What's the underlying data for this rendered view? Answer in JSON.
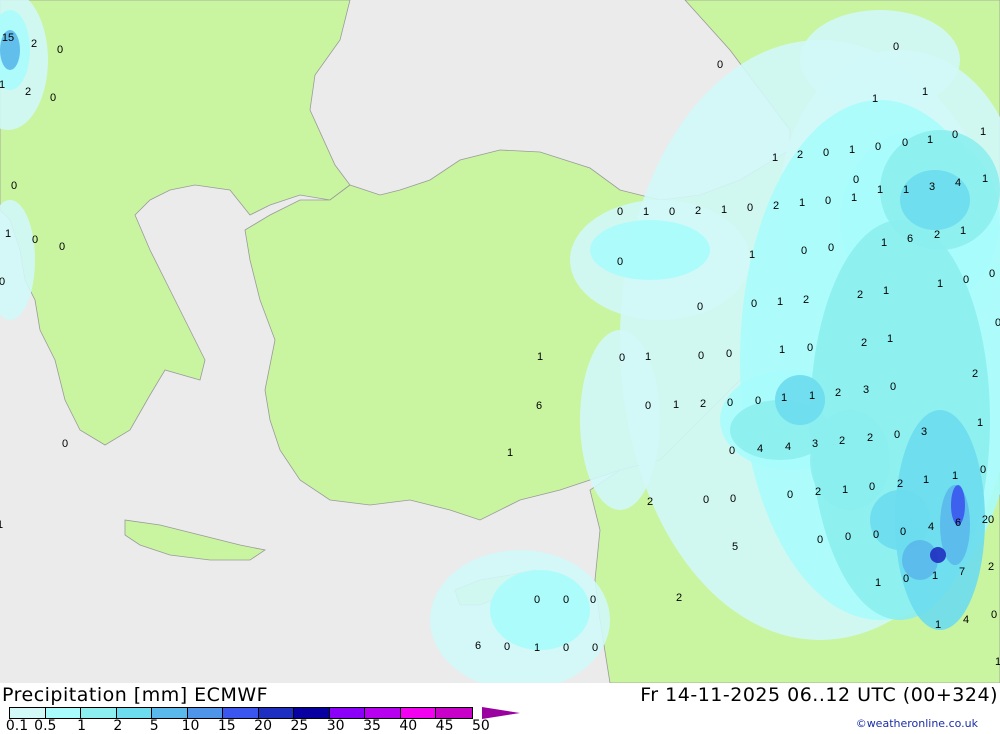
{
  "title": "Precipitation [mm] ECMWF",
  "valid_time": "Fr 14-11-2025 06..12 UTC (00+324)",
  "credit": "©weatheronline.co.uk",
  "colors": {
    "sea": "#ebebeb",
    "land": "#c9f5a0",
    "border": "#a0a0a0"
  },
  "legend": {
    "ticks": [
      "0.1",
      "0.5",
      "1",
      "2",
      "5",
      "10",
      "15",
      "20",
      "25",
      "30",
      "35",
      "40",
      "45",
      "50"
    ],
    "colors": [
      "#d2f8f8",
      "#a8fcfc",
      "#8ceeee",
      "#6cdcee",
      "#5ab8ea",
      "#4e94e8",
      "#3a56ee",
      "#1e2ec0",
      "#0800a0",
      "#8a00f8",
      "#b800f0",
      "#f200f0",
      "#c800c8"
    ],
    "overflow_color": "#9a00a0"
  },
  "station_values": [
    "15",
    "2",
    "0",
    "1",
    "2",
    "0",
    "0",
    "1",
    "0",
    "0",
    "0",
    "0",
    "1",
    "0",
    "0",
    "1",
    "1",
    "1",
    "0",
    "1",
    "0",
    "0",
    "1",
    "0",
    "2",
    "1",
    "0",
    "1",
    "1",
    "3",
    "4",
    "1",
    "0",
    "1",
    "0",
    "2",
    "1",
    "0",
    "2",
    "1",
    "0",
    "1",
    "1",
    "6",
    "2",
    "1",
    "0",
    "1",
    "0",
    "0",
    "0",
    "0",
    "1",
    "1",
    "2",
    "2",
    "1",
    "0",
    "0",
    "0",
    "1",
    "2",
    "0",
    "1",
    "0",
    "0",
    "1",
    "0",
    "1",
    "2",
    "0",
    "3",
    "2",
    "1",
    "1",
    "0",
    "0",
    "2",
    "1",
    "0",
    "6",
    "1",
    "3",
    "0",
    "2",
    "2",
    "3",
    "4",
    "4",
    "0",
    "1",
    "0",
    "1",
    "1",
    "2",
    "0",
    "1",
    "2",
    "0",
    "0",
    "0",
    "2",
    "20",
    "6",
    "4",
    "0",
    "0",
    "0",
    "0",
    "5",
    "2",
    "7",
    "1",
    "0",
    "1",
    "0",
    "0",
    "0",
    "2",
    "0",
    "4",
    "1",
    "0",
    "0",
    "1",
    "0",
    "6",
    "1"
  ]
}
